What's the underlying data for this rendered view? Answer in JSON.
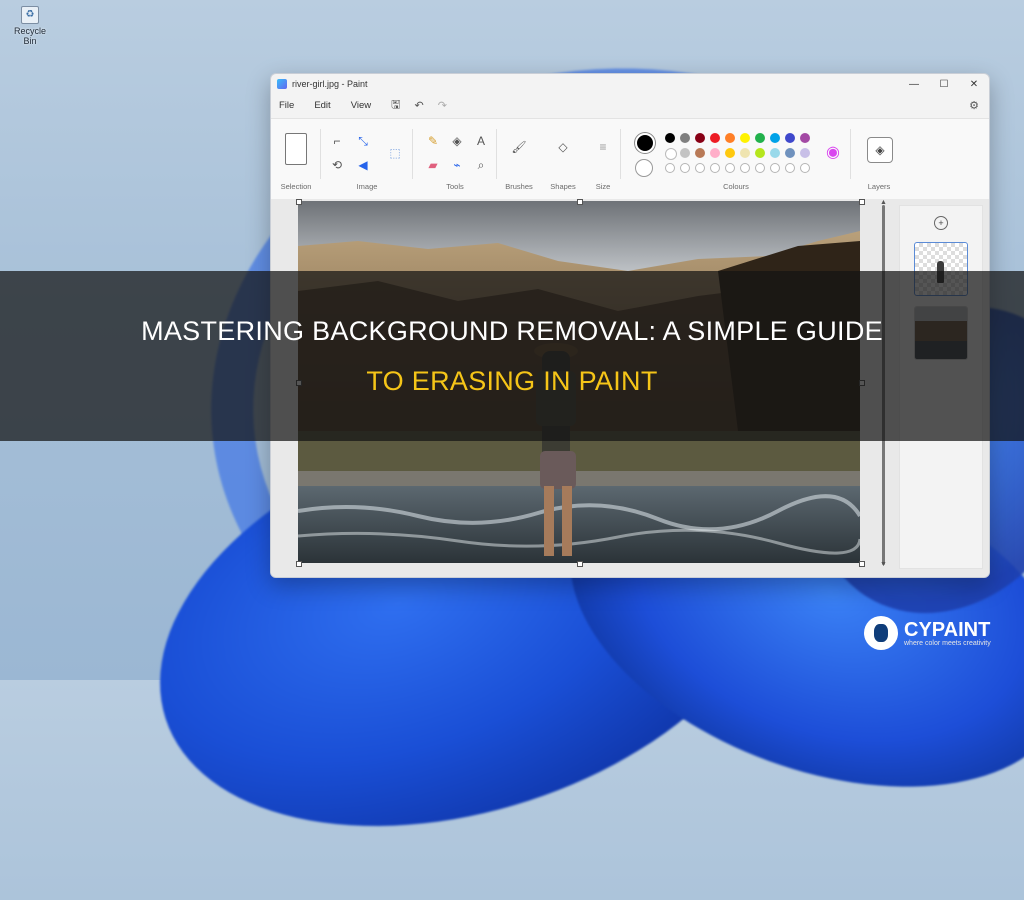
{
  "desktop": {
    "icon_label": "Recycle Bin"
  },
  "window": {
    "title": "river-girl.jpg - Paint",
    "controls": {
      "minimize": "—",
      "maximize": "☐",
      "close": "✕"
    }
  },
  "menu": {
    "items": [
      "File",
      "Edit",
      "View"
    ]
  },
  "ribbon": {
    "groups": {
      "selection": "Selection",
      "image": "Image",
      "tools": "Tools",
      "brushes": "Brushes",
      "shapes": "Shapes",
      "size": "Size",
      "colours": "Colours",
      "layers": "Layers"
    },
    "palette_row1": [
      "#000000",
      "#7f7f7f",
      "#880015",
      "#ed1c24",
      "#ff7f27",
      "#fff200",
      "#22b14c",
      "#00a2e8",
      "#3f48cc",
      "#a349a4"
    ],
    "palette_row2": [
      "#ffffff",
      "#c3c3c3",
      "#b97a57",
      "#ffaec9",
      "#ffc90e",
      "#efe4b0",
      "#b5e61d",
      "#99d9ea",
      "#7092be",
      "#c8bfe7"
    ]
  },
  "headline": {
    "line1": "MASTERING BACKGROUND REMOVAL: A SIMPLE GUIDE",
    "line2": "TO ERASING IN PAINT"
  },
  "brand": {
    "name": "CYPAINT",
    "tagline": "where color meets creativity"
  }
}
